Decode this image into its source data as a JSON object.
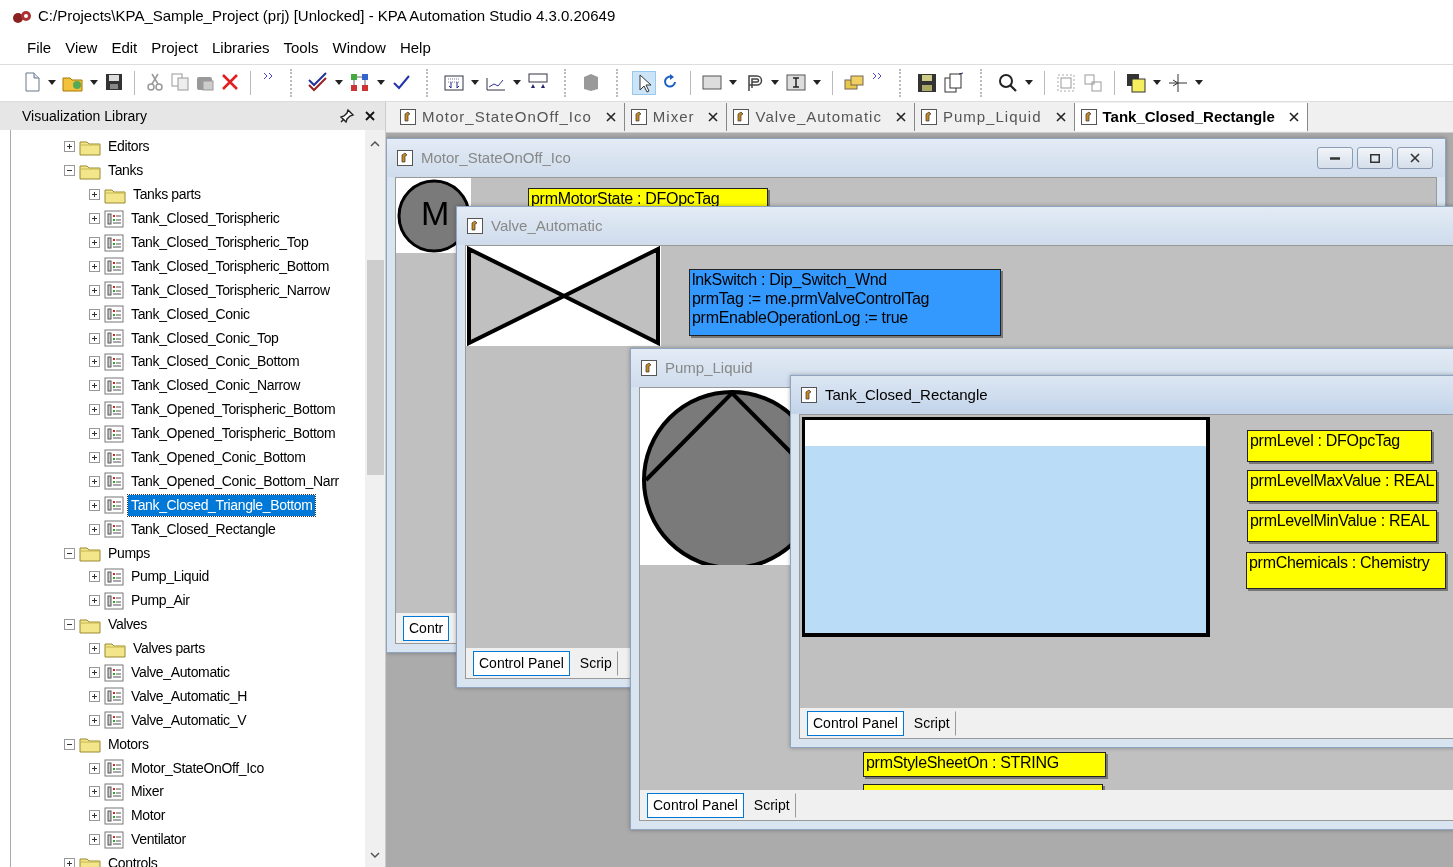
{
  "window": {
    "title": "C:/Projects\\KPA_Sample_Project (prj) [Unlocked] - KPA Automation Studio 4.3.0.20649"
  },
  "menu": [
    "File",
    "View",
    "Edit",
    "Project",
    "Libraries",
    "Tools",
    "Window",
    "Help"
  ],
  "sidebar": {
    "title": "Visualization Library",
    "tree": [
      {
        "label": "Editors",
        "kind": "folder",
        "expanded": false,
        "selected": false
      },
      {
        "label": "Tanks",
        "kind": "folder",
        "expanded": true,
        "selected": false,
        "children": [
          {
            "label": "Tanks parts",
            "kind": "folder",
            "expanded": false,
            "selected": false
          },
          {
            "label": "Tank_Closed_Torispheric",
            "kind": "element",
            "expanded": false,
            "selected": false
          },
          {
            "label": "Tank_Closed_Torispheric_Top",
            "kind": "element",
            "expanded": false,
            "selected": false
          },
          {
            "label": "Tank_Closed_Torispheric_Bottom",
            "kind": "element",
            "expanded": false,
            "selected": false
          },
          {
            "label": "Tank_Closed_Torispheric_Narrow",
            "kind": "element",
            "expanded": false,
            "selected": false
          },
          {
            "label": "Tank_Closed_Conic",
            "kind": "element",
            "expanded": false,
            "selected": false
          },
          {
            "label": "Tank_Closed_Conic_Top",
            "kind": "element",
            "expanded": false,
            "selected": false
          },
          {
            "label": "Tank_Closed_Conic_Bottom",
            "kind": "element",
            "expanded": false,
            "selected": false
          },
          {
            "label": "Tank_Closed_Conic_Narrow",
            "kind": "element",
            "expanded": false,
            "selected": false
          },
          {
            "label": "Tank_Opened_Torispheric_Bottom",
            "kind": "element",
            "expanded": false,
            "selected": false
          },
          {
            "label": "Tank_Opened_Torispheric_Bottom",
            "kind": "element",
            "expanded": false,
            "selected": false
          },
          {
            "label": "Tank_Opened_Conic_Bottom",
            "kind": "element",
            "expanded": false,
            "selected": false
          },
          {
            "label": "Tank_Opened_Conic_Bottom_Narr",
            "kind": "element",
            "expanded": false,
            "selected": false
          },
          {
            "label": "Tank_Closed_Triangle_Bottom",
            "kind": "element",
            "expanded": false,
            "selected": true
          },
          {
            "label": "Tank_Closed_Rectangle",
            "kind": "element",
            "expanded": false,
            "selected": false
          }
        ]
      },
      {
        "label": "Pumps",
        "kind": "folder",
        "expanded": true,
        "selected": false,
        "children": [
          {
            "label": "Pump_Liquid",
            "kind": "element",
            "expanded": false,
            "selected": false
          },
          {
            "label": "Pump_Air",
            "kind": "element",
            "expanded": false,
            "selected": false
          }
        ]
      },
      {
        "label": "Valves",
        "kind": "folder",
        "expanded": true,
        "selected": false,
        "children": [
          {
            "label": "Valves parts",
            "kind": "folder",
            "expanded": false,
            "selected": false
          },
          {
            "label": "Valve_Automatic",
            "kind": "element",
            "expanded": false,
            "selected": false
          },
          {
            "label": "Valve_Automatic_H",
            "kind": "element",
            "expanded": false,
            "selected": false
          },
          {
            "label": "Valve_Automatic_V",
            "kind": "element",
            "expanded": false,
            "selected": false
          }
        ]
      },
      {
        "label": "Motors",
        "kind": "folder",
        "expanded": true,
        "selected": false,
        "children": [
          {
            "label": "Motor_StateOnOff_Ico",
            "kind": "element",
            "expanded": false,
            "selected": false
          },
          {
            "label": "Mixer",
            "kind": "element",
            "expanded": false,
            "selected": false
          },
          {
            "label": "Motor",
            "kind": "element",
            "expanded": false,
            "selected": false
          },
          {
            "label": "Ventilator",
            "kind": "element",
            "expanded": false,
            "selected": false
          }
        ]
      },
      {
        "label": "Controls",
        "kind": "folder",
        "expanded": false,
        "selected": false
      }
    ]
  },
  "tabs": [
    {
      "label": "Motor_StateOnOff_Ico",
      "selected": false
    },
    {
      "label": "Mixer",
      "selected": false
    },
    {
      "label": "Valve_Automatic",
      "selected": false
    },
    {
      "label": "Pump_Liquid",
      "selected": false
    },
    {
      "label": "Tank_Closed_Rectangle",
      "selected": true
    }
  ],
  "documents": [
    {
      "title": "Motor_StateOnOff_Ico",
      "active": false,
      "kind": "motor",
      "drawing_text": "M",
      "labels": [
        {
          "text": "prmMotorState : DFOpcTag",
          "color": "#ffff00"
        }
      ],
      "footer_tabs": [
        {
          "label": "Contr",
          "selected": true
        }
      ]
    },
    {
      "title": "Valve_Automatic",
      "active": false,
      "kind": "valve",
      "labels": [
        {
          "text": "lnkSwitch : Dip_Switch_Wnd\nprmTag := me.prmValveControlTag\nprmEnableOperationLog := true",
          "color": "#3399ff"
        }
      ],
      "footer_tabs": [
        {
          "label": "Control Panel",
          "selected": true
        },
        {
          "label": "Scrip",
          "selected": false
        }
      ]
    },
    {
      "title": "Pump_Liquid",
      "active": false,
      "kind": "pump",
      "labels": [
        {
          "text": "prmStyleSheetOn : STRING",
          "color": "#ffff00"
        },
        {
          "color": "#ffff00"
        }
      ],
      "footer_tabs": [
        {
          "label": "Control Panel",
          "selected": true
        },
        {
          "label": "Script",
          "selected": false
        }
      ]
    },
    {
      "title": "Tank_Closed_Rectangle",
      "active": true,
      "kind": "tank",
      "labels": [
        {
          "text": "prmLevel : DFOpcTag",
          "color": "#ffff00"
        },
        {
          "text": "prmLevelMaxValue : REAL",
          "color": "#ffff00"
        },
        {
          "text": "prmLevelMinValue : REAL",
          "color": "#ffff00"
        },
        {
          "text": "prmChemicals : Chemistry",
          "color": "#ffff00"
        }
      ],
      "footer_tabs": [
        {
          "label": "Control Panel",
          "selected": true
        },
        {
          "label": "Script",
          "selected": false
        }
      ]
    }
  ]
}
